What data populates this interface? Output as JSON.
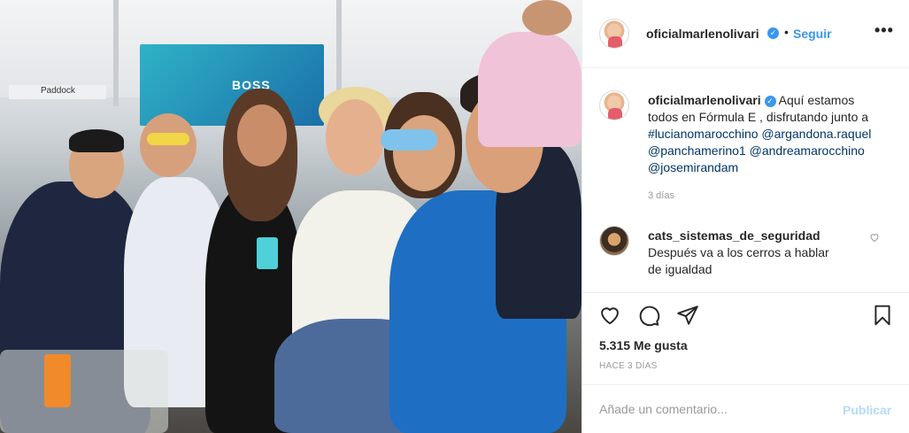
{
  "photo": {
    "banner_text": "BOSS",
    "paddock_text": "Paddock"
  },
  "header": {
    "username": "oficialmarlenolivari",
    "verified_icon": "verified-badge-icon",
    "separator": "•",
    "follow_label": "Seguir",
    "more_label": "•••"
  },
  "caption": {
    "username": "oficialmarlenolivari",
    "text_before": "Aquí estamos todos en Fórmula E , disfrutando junto a",
    "mentions": [
      "#lucianomarocchino",
      "@argandona.raquel",
      "@panchamerino1",
      "@andreamarocchino",
      "@josemirandam"
    ],
    "time": "3 días"
  },
  "comment": {
    "username": "cats_sistemas_de_seguridad",
    "text": "Después va a los cerros a hablar de igualdad"
  },
  "actions": {
    "icons": [
      "heart-icon",
      "comment-icon",
      "share-icon",
      "bookmark-icon"
    ],
    "likes": "5.315 Me gusta",
    "time_ago": "HACE 3 DÍAS"
  },
  "add_comment": {
    "placeholder": "Añade un comentario...",
    "publish_label": "Publicar"
  },
  "colors": {
    "accent": "#3897f0",
    "mention": "#003569",
    "publish_disabled": "#b3dbff",
    "muted": "#999999"
  }
}
